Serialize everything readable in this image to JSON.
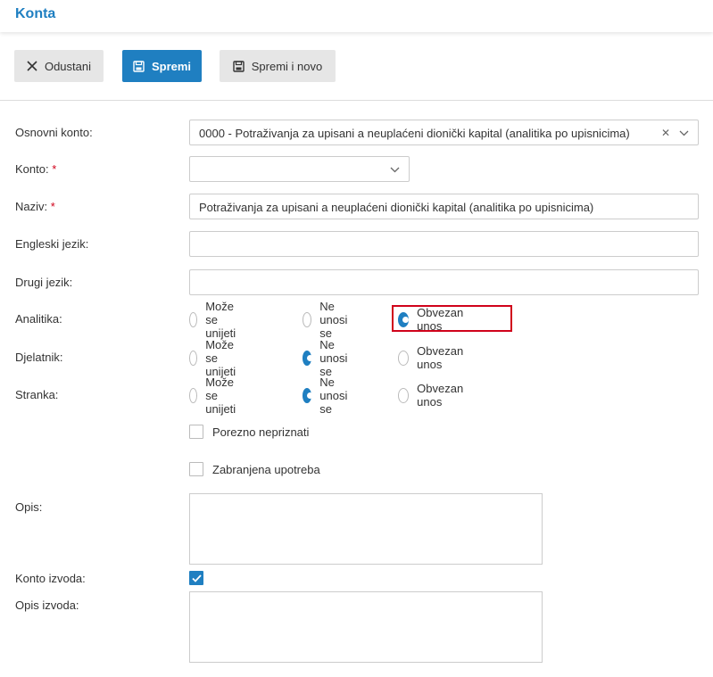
{
  "header": {
    "title": "Konta"
  },
  "toolbar": {
    "cancel_label": "Odustani",
    "save_label": "Spremi",
    "save_new_label": "Spremi i novo"
  },
  "form": {
    "osnovni_konto": {
      "label": "Osnovni konto:",
      "value": "0000 - Potraživanja za upisani a neuplaćeni dionički kapital (analitika po upisnicima)"
    },
    "konto": {
      "label": "Konto:",
      "required_mark": "*",
      "value": ""
    },
    "naziv": {
      "label": "Naziv:",
      "required_mark": "*",
      "value": "Potraživanja za upisani a neuplaćeni dionički kapital (analitika po upisnicima)"
    },
    "engleski": {
      "label": "Engleski jezik:",
      "value": ""
    },
    "drugi": {
      "label": "Drugi jezik:",
      "value": ""
    },
    "radio_options": [
      "Može se unijeti",
      "Ne unosi se",
      "Obvezan unos"
    ],
    "analitika": {
      "label": "Analitika:",
      "selected": "Obvezan unos"
    },
    "djelatnik": {
      "label": "Djelatnik:",
      "selected": "Ne unosi se"
    },
    "stranka": {
      "label": "Stranka:",
      "selected": "Ne unosi se"
    },
    "porezno": {
      "label": "Porezno nepriznati",
      "checked": false
    },
    "zabranjena": {
      "label": "Zabranjena upotreba",
      "checked": false
    },
    "opis": {
      "label": "Opis:",
      "value": ""
    },
    "konto_izvoda": {
      "label": "Konto izvoda:",
      "checked": true
    },
    "opis_izvoda": {
      "label": "Opis izvoda:",
      "value": ""
    }
  },
  "colors": {
    "accent": "#1f7fc1",
    "highlight": "#d0021b",
    "button_grey": "#e6e6e6"
  }
}
